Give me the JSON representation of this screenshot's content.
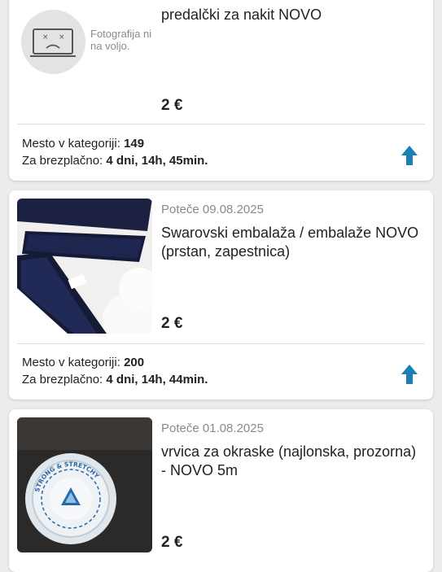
{
  "listings": [
    {
      "title": "predalčki za nakit NOVO",
      "no_photo_text": "Fotografija ni na voljo.",
      "price": "2 €",
      "rank_label": "Mesto v kategoriji:",
      "rank_value": "149",
      "free_label": "Za brezplačno:",
      "free_value": "4 dni, 14h, 45min.",
      "icon": "arrow-up-icon"
    },
    {
      "expiry": "Poteče 09.08.2025",
      "title": "Swarovski embalaža / embalaže NOVO (prstan, zapestnica)",
      "price": "2 €",
      "rank_label": "Mesto v kategoriji:",
      "rank_value": "200",
      "free_label": "Za brezplačno:",
      "free_value": "4 dni, 14h, 44min.",
      "icon": "arrow-up-icon"
    },
    {
      "expiry": "Poteče 01.08.2025",
      "title": "vrvica za okraske (najlonska, prozorna) - NOVO 5m",
      "price": "2 €",
      "spool_text": "STRONG & STRETCHY"
    }
  ],
  "colors": {
    "accent": "#1a7fb3",
    "background": "#ececec"
  }
}
